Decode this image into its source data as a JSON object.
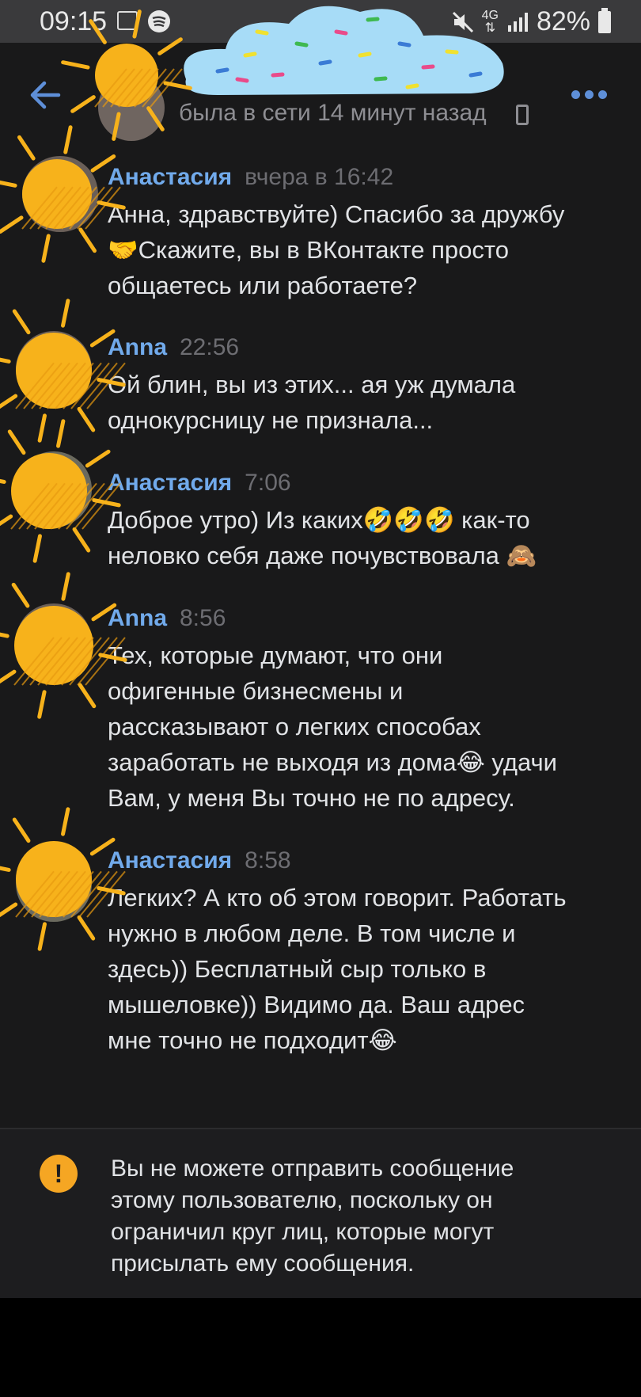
{
  "status_bar": {
    "time": "09:15",
    "network": "4G",
    "battery": "82%"
  },
  "header": {
    "last_seen": "была в сети 14 минут назад"
  },
  "messages": [
    {
      "author": "Анастасия",
      "time": "вчера в 16:42",
      "lines": [
        "Анна, здравствуйте) Спасибо за дружбу",
        "🤝Скажите, вы в ВКонтакте просто",
        "общаетесь или работаете?"
      ]
    },
    {
      "author": "Anna",
      "time": "22:56",
      "lines": [
        "Ой блин, вы из этих... ая уж думала",
        "однокурсницу не признала..."
      ]
    },
    {
      "author": "Анастасия",
      "time": "7:06",
      "lines": [
        "Доброе утро) Из каких🤣🤣🤣 как-то",
        "неловко себя даже почувствовала 🙈"
      ]
    },
    {
      "author": "Anna",
      "time": "8:56",
      "lines": [
        "Тех, которые думают, что они",
        "офигенные бизнесмены и",
        "рассказывают о легких способах",
        "заработать не выходя из дома😂 удачи",
        "Вам, у меня Вы точно не по адресу."
      ]
    },
    {
      "author": "Анастасия",
      "time": "8:58",
      "lines": [
        "Легких? А кто об этом говорит. Работать",
        "нужно в любом деле. В том числе и",
        "здесь)) Бесплатный сыр только в",
        "мышеловке)) Видимо да. Ваш адрес",
        "мне точно не подходит😂"
      ]
    }
  ],
  "notice": {
    "icon": "exclamation-icon",
    "lines": [
      "Вы не можете отправить сообщение",
      "этому пользователю, поскольку он",
      "ограничил круг лиц, которые могут",
      "присылать ему сообщения."
    ]
  },
  "colors": {
    "background": "#19191a",
    "author": "#71aaeb",
    "accent": "#5e8fd8",
    "warning": "#f5a623",
    "sun": "#f7b21b"
  }
}
